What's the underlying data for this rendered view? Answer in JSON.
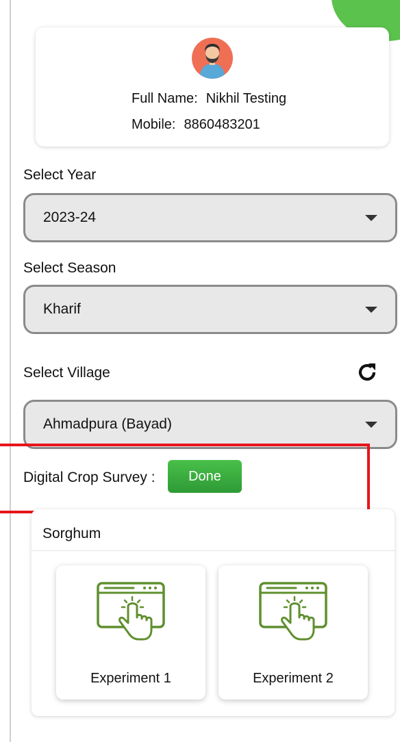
{
  "profile": {
    "name_label": "Full Name:",
    "name_value": "Nikhil Testing",
    "mobile_label": "Mobile:",
    "mobile_value": "8860483201"
  },
  "year": {
    "label": "Select Year",
    "value": "2023-24"
  },
  "season": {
    "label": "Select Season",
    "value": "Kharif"
  },
  "village": {
    "label": "Select Village",
    "value": "Ahmadpura (Bayad)"
  },
  "survey": {
    "label": "Digital Crop Survey :",
    "status": "Done"
  },
  "crop": {
    "name": "Sorghum",
    "experiments": [
      {
        "label": "Experiment 1",
        "icon": "tap-screen-icon"
      },
      {
        "label": "Experiment 2",
        "icon": "tap-screen-icon"
      }
    ]
  },
  "colors": {
    "accent_green": "#3aae3f",
    "highlight_red": "#e8141b",
    "icon_green": "#5a8a2a"
  }
}
